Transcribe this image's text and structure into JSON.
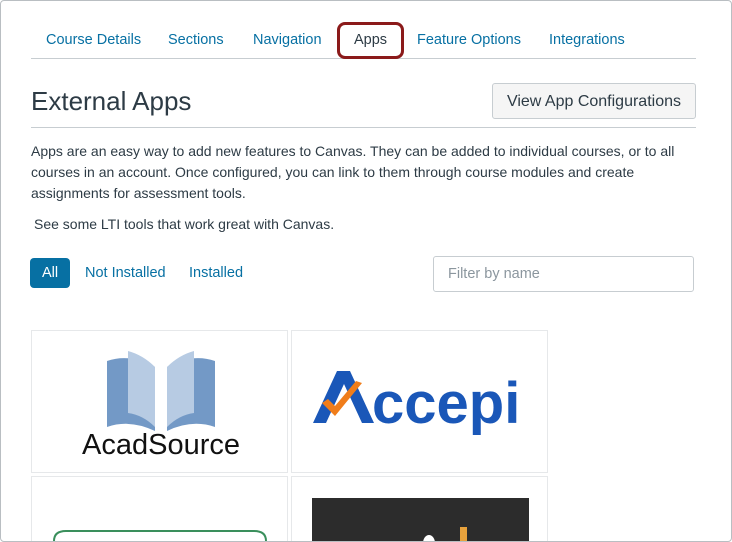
{
  "tabs": {
    "items": [
      "Course Details",
      "Sections",
      "Navigation",
      "Apps",
      "Feature Options",
      "Integrations"
    ],
    "active": "Apps"
  },
  "header": {
    "title": "External Apps",
    "config_button": "View App Configurations"
  },
  "description": "Apps are an easy way to add new features to Canvas. They can be added to individual courses, or to all courses in an account. Once configured, you can link to them through course modules and create assignments for assessment tools.",
  "lti_text": "See some LTI tools that work great with Canvas.",
  "filters": {
    "all": "All",
    "not_installed": "Not Installed",
    "installed": "Installed",
    "search_placeholder": "Filter by name"
  },
  "apps": [
    {
      "name": "AcadSource",
      "logo_text": "AcadSource"
    },
    {
      "name": "Accepi",
      "logo_text": "ccepi"
    }
  ],
  "colors": {
    "link": "#0770a3",
    "active_filter": "#0770a3",
    "highlight_border": "#8b1a1a",
    "accepi_blue": "#1a57b8",
    "accepi_orange": "#f07d1a",
    "book_blue": "#7399c6"
  }
}
